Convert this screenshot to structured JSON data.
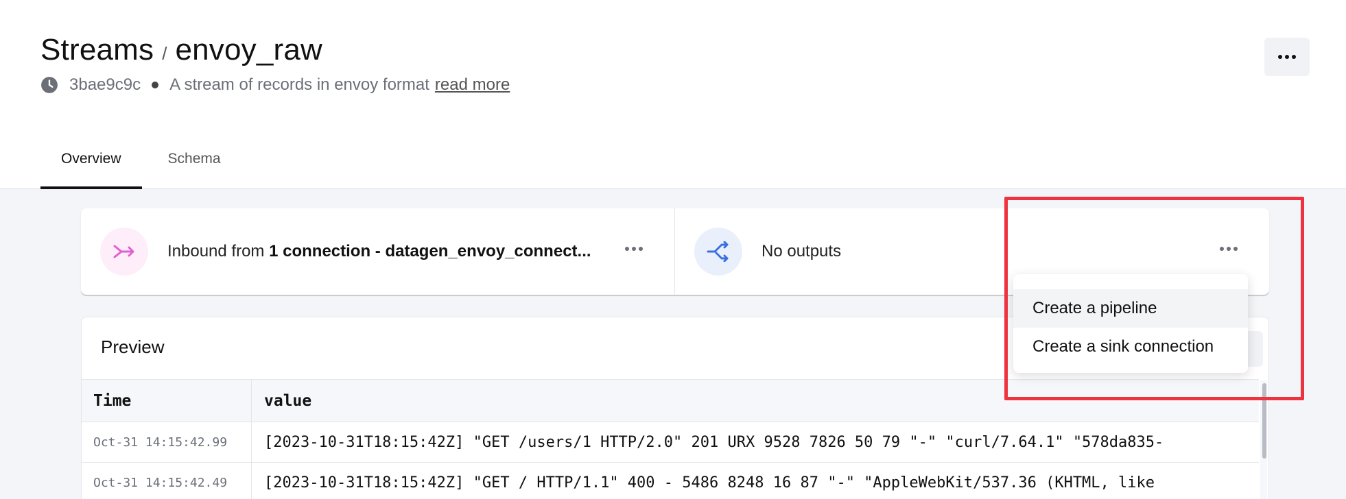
{
  "header": {
    "breadcrumb_root": "Streams",
    "separator": "/",
    "stream_name": "envoy_raw",
    "version": "3bae9c9c",
    "description": "A stream of records in envoy format",
    "read_more": "read more",
    "more_icon": "more-horizontal-icon"
  },
  "tabs": [
    {
      "label": "Overview",
      "active": true
    },
    {
      "label": "Schema",
      "active": false
    }
  ],
  "inbound": {
    "prefix": "Inbound from",
    "connection_text": "1 connection - datagen_envoy_connect...",
    "icon": "merge-arrow-icon",
    "icon_color": "#e060d0"
  },
  "outputs": {
    "label": "No outputs",
    "icon": "shuffle-icon",
    "icon_color": "#3b6fe0"
  },
  "dropdown": {
    "items": [
      "Create a pipeline",
      "Create a sink connection"
    ]
  },
  "preview": {
    "title": "Preview",
    "columns": [
      "Time",
      "value"
    ],
    "rows": [
      {
        "time": "Oct-31 14:15:42.99",
        "value": "[2023-10-31T18:15:42Z] \"GET /users/1 HTTP/2.0\" 201 URX 9528 7826 50 79 \"-\" \"curl/7.64.1\" \"578da835-"
      },
      {
        "time": "Oct-31 14:15:42.49",
        "value": "[2023-10-31T18:15:42Z] \"GET / HTTP/1.1\" 400 - 5486 8248 16 87 \"-\" \"AppleWebKit/537.36 (KHTML, like"
      }
    ]
  },
  "colors": {
    "highlight": "#ee3340",
    "tab_underline": "#111111"
  }
}
